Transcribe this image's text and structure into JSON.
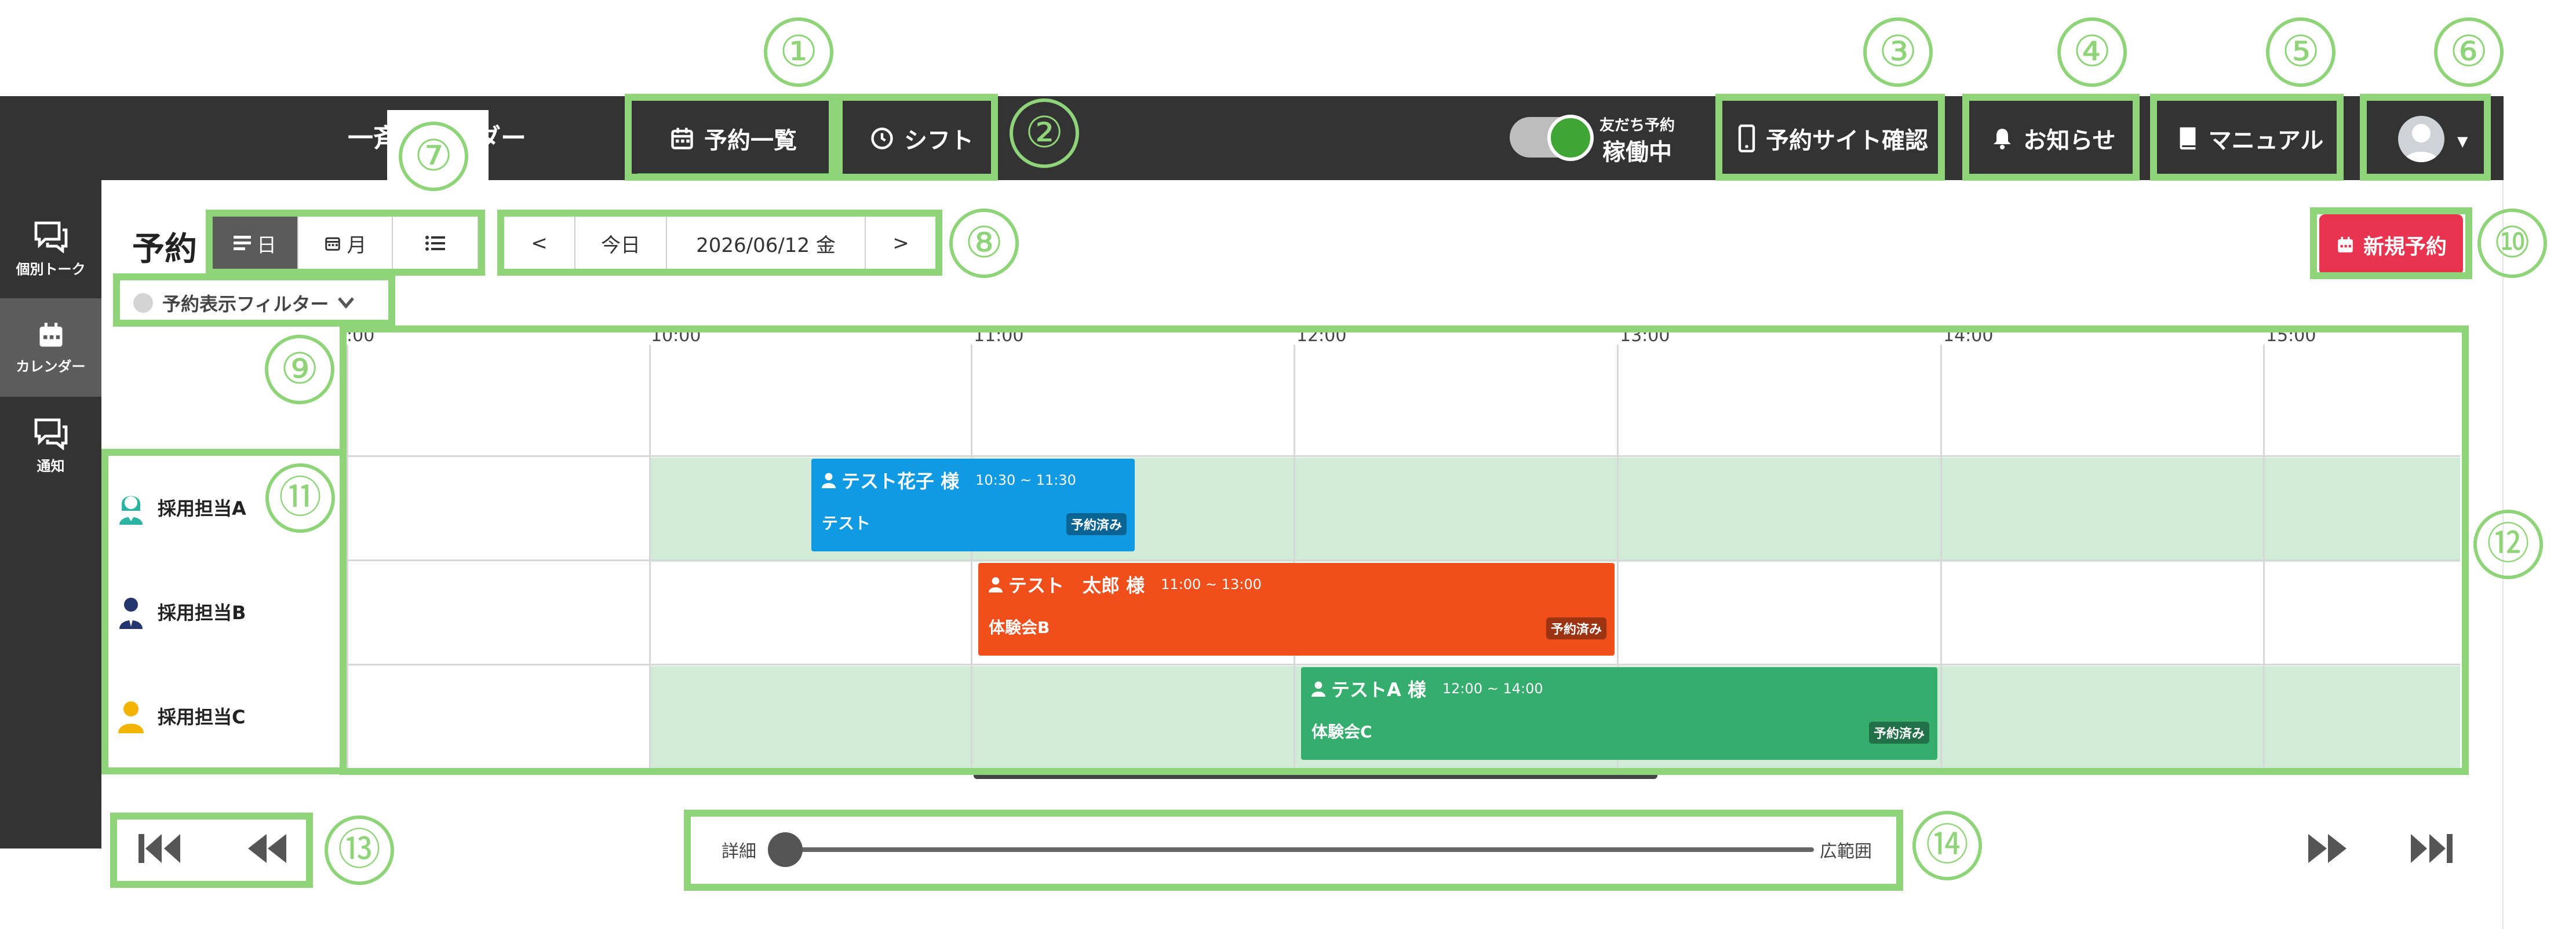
{
  "header": {
    "app_title": "一斉カレンダー",
    "tabs": [
      {
        "label": "予約一覧",
        "icon": "calendar-icon",
        "active": true
      },
      {
        "label": "シフト",
        "icon": "clock-icon",
        "active": false
      }
    ],
    "friend_booking": {
      "label": "友だち予約",
      "status": "稼働中",
      "enabled": true
    },
    "actions": [
      {
        "label": "予約サイト確認",
        "icon": "smartphone-icon"
      },
      {
        "label": "お知らせ",
        "icon": "bell-icon"
      },
      {
        "label": "マニュアル",
        "icon": "book-icon"
      }
    ],
    "user_menu_icon": "avatar-icon"
  },
  "sidebar": {
    "items": [
      {
        "label": "個別トーク",
        "icon": "chat-icon",
        "active": false
      },
      {
        "label": "カレンダー",
        "icon": "calendar-icon",
        "active": true
      },
      {
        "label": "通知",
        "icon": "chat-icon",
        "active": false
      }
    ]
  },
  "toolbar": {
    "title": "予約",
    "view_modes": [
      {
        "label": "日",
        "icon": "list-lines-icon",
        "active": true
      },
      {
        "label": "月",
        "icon": "calendar-grid-icon",
        "active": false
      },
      {
        "label": "",
        "icon": "list-icon",
        "active": false
      }
    ],
    "date_nav": {
      "prev": "<",
      "today": "今日",
      "date": "2026/06/12 金",
      "next": ">"
    },
    "filter_label": "予約表示フィルター",
    "new_booking_label": "新規予約"
  },
  "timeline": {
    "time_labels": [
      ":00",
      "10:00",
      "11:00",
      "12:00",
      "13:00",
      "14:00",
      "15:00"
    ],
    "staff": [
      {
        "name": "採用担当A",
        "icon": "woman-staff-icon",
        "color": "#2bb3a3"
      },
      {
        "name": "採用担当B",
        "icon": "man-suit-icon",
        "color": "#23366e"
      },
      {
        "name": "採用担当C",
        "icon": "person-icon",
        "color": "#f2b400"
      }
    ],
    "bookings": [
      {
        "name": "テスト花子 様",
        "time": "10:30 ~ 11:30",
        "title": "テスト",
        "status": "予約済み",
        "color": "#0f9ae3"
      },
      {
        "name": "テスト　太郎 様",
        "time": "11:00 ~ 13:00",
        "title": "体験会B",
        "status": "予約済み",
        "color": "#f04f1c"
      },
      {
        "name": "テストA 様",
        "time": "12:00 ~ 14:00",
        "title": "体験会C",
        "status": "予約済み",
        "color": "#35ad6d"
      }
    ]
  },
  "zoom": {
    "min_label": "詳細",
    "max_label": "広範囲",
    "level": 0.0
  },
  "annotations": [
    "①",
    "②",
    "③",
    "④",
    "⑤",
    "⑥",
    "⑦",
    "⑧",
    "⑨",
    "⑩",
    "⑪",
    "⑫",
    "⑬",
    "⑭"
  ],
  "colors": {
    "annotation": "#8fd478",
    "header_bg": "#333333",
    "accent": "#e8344e",
    "available": "#d1ecd6"
  }
}
